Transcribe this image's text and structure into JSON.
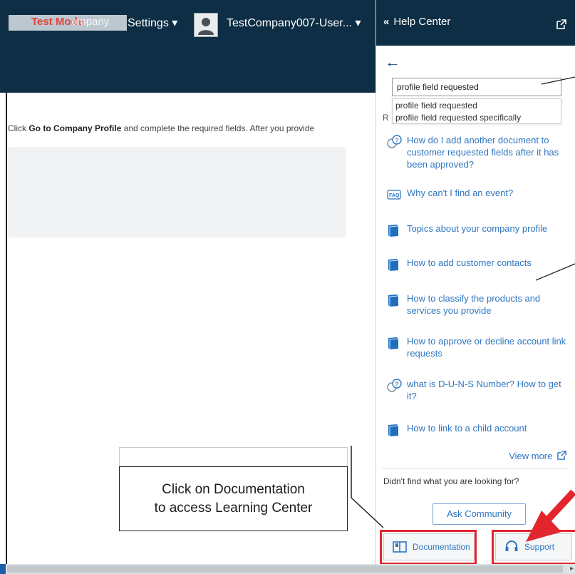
{
  "header": {
    "brand_overlay": "Test Mode",
    "brand_ghost_text": "ompany",
    "settings_label": "Settings ▾",
    "user_name": "TestCompany007-User... ▾"
  },
  "main": {
    "instruction_prefix": "Click ",
    "instruction_link": "Go to Company Profile",
    "instruction_suffix": " and complete the required fields. After you provide"
  },
  "help_center": {
    "title": "Help Center",
    "search_value": "profile field requested",
    "suggestions": [
      "profile field requested",
      "profile field requested specifically"
    ],
    "results_peek": "R",
    "topics": [
      {
        "icon": "question-bubble-icon",
        "text": "How do I add another document to customer requested fields after it has been approved?"
      },
      {
        "icon": "faq-icon",
        "text": "Why can't I find an event?"
      },
      {
        "icon": "book-icon",
        "text": "Topics about your company profile"
      },
      {
        "icon": "book-icon",
        "text": "How to add customer contacts"
      },
      {
        "icon": "book-icon",
        "text": "How to classify the products and services you provide"
      },
      {
        "icon": "book-icon",
        "text": "How to approve or decline account link requests"
      },
      {
        "icon": "question-bubble-icon",
        "text": "what is D-U-N-S Number? How to get it?"
      },
      {
        "icon": "book-icon",
        "text": "How to link to a child account"
      }
    ],
    "view_more": "View more",
    "didnt_find": "Didn't find what you are looking for?",
    "ask_community": "Ask Community",
    "documentation": "Documentation",
    "support": "Support"
  },
  "callout": {
    "line1": "Click on Documentation",
    "line2": "to access Learning Center"
  },
  "colors": {
    "header_bg": "#0d2e44",
    "link": "#2f76c1",
    "highlight": "#e3262e"
  }
}
